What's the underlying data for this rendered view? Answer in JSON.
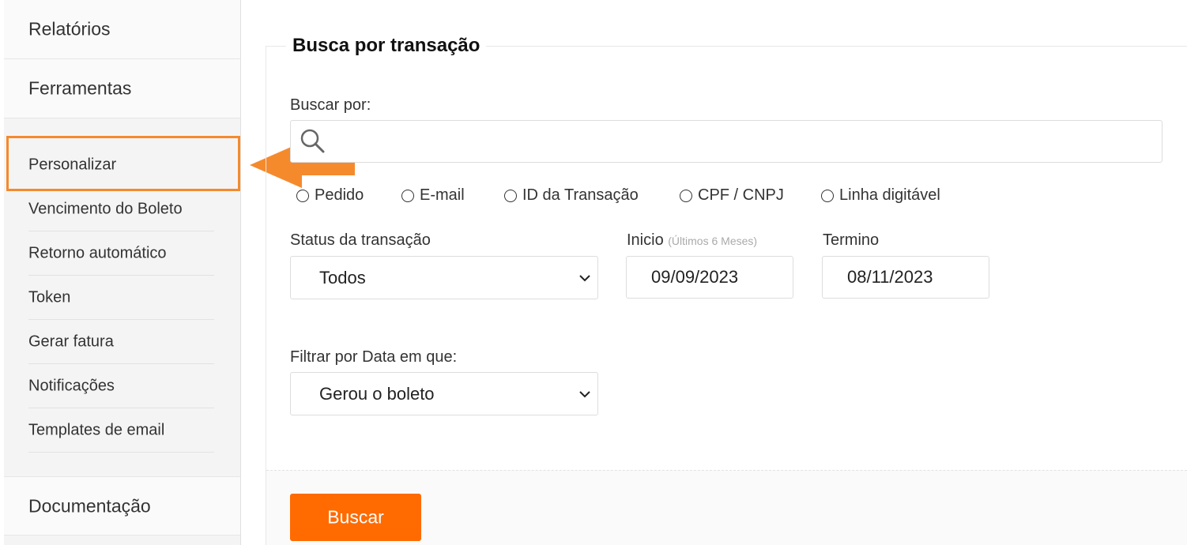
{
  "sidebar": {
    "reports_label": "Relatórios",
    "tools_label": "Ferramentas",
    "items": [
      {
        "label": "Personalizar"
      },
      {
        "label": "Vencimento do Boleto"
      },
      {
        "label": "Retorno automático"
      },
      {
        "label": "Token"
      },
      {
        "label": "Gerar fatura"
      },
      {
        "label": "Notificações"
      },
      {
        "label": "Templates de email"
      }
    ],
    "docs_label": "Documentação",
    "highlight_color": "#f58a2d"
  },
  "panel": {
    "title": "Busca por transação",
    "search": {
      "label": "Buscar por:",
      "value": "",
      "placeholder": ""
    },
    "search_options": [
      {
        "label": "Pedido"
      },
      {
        "label": "E-mail"
      },
      {
        "label": "ID da Transação"
      },
      {
        "label": "CPF / CNPJ"
      },
      {
        "label": "Linha digitável"
      }
    ],
    "status": {
      "label": "Status da transação",
      "selected": "Todos"
    },
    "start": {
      "label": "Inicio",
      "hint": "(Últimos 6 Meses)",
      "value": "09/09/2023"
    },
    "end": {
      "label": "Termino",
      "value": "08/11/2023"
    },
    "date_filter": {
      "label": "Filtrar por Data em que:",
      "selected": "Gerou o boleto"
    },
    "search_button": "Buscar",
    "accent_color": "#ff6b00"
  }
}
